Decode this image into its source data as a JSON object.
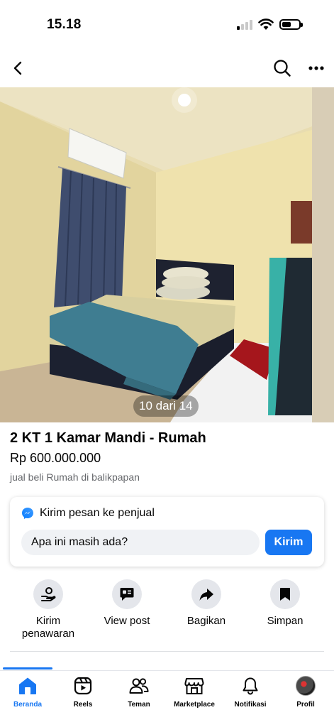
{
  "status_bar": {
    "time": "15.18"
  },
  "listing": {
    "photo_counter": "10 dari 14",
    "title": "2 KT 1 Kamar Mandi - Rumah",
    "price": "Rp 600.000.000",
    "subtitle": "jual beli Rumah di balikpapan"
  },
  "message": {
    "heading": "Kirim pesan ke penjual",
    "input_value": "Apa ini masih ada?",
    "send_label": "Kirim"
  },
  "actions": [
    {
      "label": "Kirim penawaran",
      "icon": "offer-hand-icon"
    },
    {
      "label": "View post",
      "icon": "post-icon"
    },
    {
      "label": "Bagikan",
      "icon": "share-arrow-icon"
    },
    {
      "label": "Simpan",
      "icon": "bookmark-icon"
    }
  ],
  "tabs": [
    {
      "label": "Beranda",
      "icon": "home-icon",
      "active": true
    },
    {
      "label": "Reels",
      "icon": "reels-icon"
    },
    {
      "label": "Teman",
      "icon": "friends-icon"
    },
    {
      "label": "Marketplace",
      "icon": "marketplace-icon"
    },
    {
      "label": "Notifikasi",
      "icon": "bell-icon"
    },
    {
      "label": "Profil",
      "icon": "avatar"
    }
  ],
  "colors": {
    "accent": "#1877f2",
    "text": "#050505",
    "muted": "#65676b"
  }
}
